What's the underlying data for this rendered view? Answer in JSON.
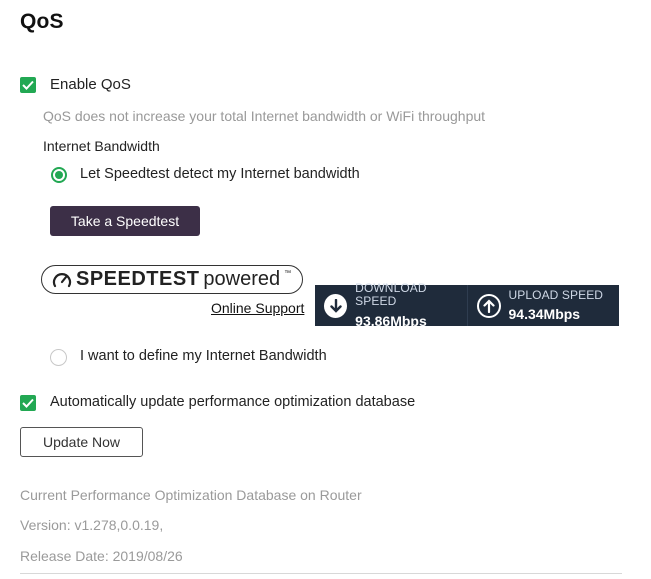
{
  "page": {
    "title": "QoS"
  },
  "enable_qos": {
    "label": "Enable QoS",
    "checked": true
  },
  "qos_hint": "QoS does not increase your total Internet bandwidth or WiFi throughput",
  "bandwidth": {
    "heading": "Internet Bandwidth",
    "option_speedtest": {
      "label": "Let Speedtest detect my Internet bandwidth",
      "selected": true
    },
    "speedtest_button": "Take a Speedtest",
    "logo": {
      "brand": "SPEEDTEST",
      "suffix": "powered",
      "tm": "™"
    },
    "online_support": "Online Support",
    "download": {
      "label": "DOWNLOAD SPEED",
      "value": "93.86Mbps"
    },
    "upload": {
      "label": "UPLOAD SPEED",
      "value": "94.34Mbps"
    },
    "option_manual": {
      "label": "I want to define my Internet Bandwidth",
      "selected": false
    }
  },
  "auto_update": {
    "label": "Automatically update performance optimization database",
    "checked": true
  },
  "update_button": "Update Now",
  "database": {
    "heading": "Current Performance Optimization Database on Router",
    "version": "Version: v1.278,0.0.19,",
    "release_date": "Release Date: 2019/08/26"
  },
  "colors": {
    "accent": "#22a853",
    "button_dark": "#3c2f47",
    "speed_panel": "#1f2b3b"
  }
}
